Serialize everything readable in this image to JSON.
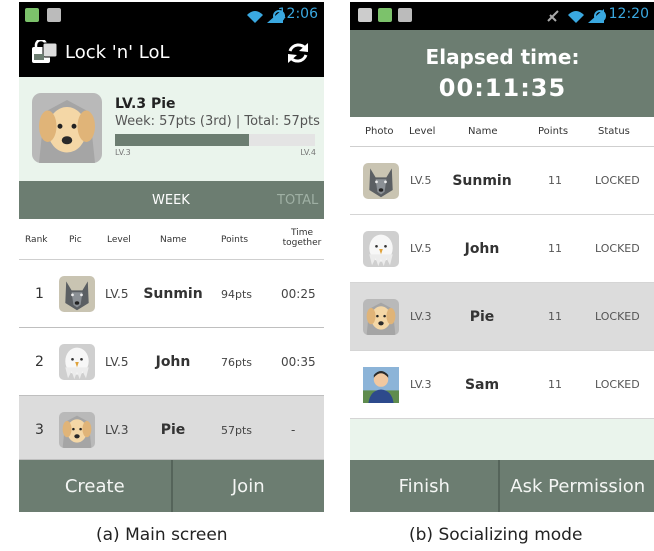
{
  "main_screen": {
    "status_time": "12:06",
    "app_title": "Lock 'n' LoL",
    "profile": {
      "name": "LV.3 Pie",
      "week_text": "Week: 57pts (3rd) | Total: 57pts",
      "level_from": "LV.3",
      "level_to": "LV.4",
      "progress": 0.67
    },
    "tabs": [
      "WEEK",
      "TOTAL"
    ],
    "headers": {
      "rank": "Rank",
      "pic": "Pic",
      "level": "Level",
      "name": "Name",
      "points": "Points",
      "time": "Time together"
    },
    "rows": [
      {
        "rank": "1",
        "level": "LV.5",
        "name": "Sunmin",
        "points": "94pts",
        "time": "00:25",
        "pic": "wolf-avatar"
      },
      {
        "rank": "2",
        "level": "LV.5",
        "name": "John",
        "points": "76pts",
        "time": "00:35",
        "pic": "eagle-avatar"
      },
      {
        "rank": "3",
        "level": "LV.3",
        "name": "Pie",
        "points": "57pts",
        "time": "-",
        "pic": "dog-avatar"
      }
    ],
    "buttons": {
      "create": "Create",
      "join": "Join"
    }
  },
  "social_screen": {
    "status_time": "12:20",
    "elapsed_label": "Elapsed time:",
    "elapsed_time": "00:11:35",
    "headers": {
      "photo": "Photo",
      "level": "Level",
      "name": "Name",
      "points": "Points",
      "status": "Status"
    },
    "rows": [
      {
        "level": "LV.5",
        "name": "Sunmin",
        "points": "11",
        "status": "LOCKED",
        "pic": "wolf-avatar"
      },
      {
        "level": "LV.5",
        "name": "John",
        "points": "11",
        "status": "LOCKED",
        "pic": "eagle-avatar"
      },
      {
        "level": "LV.3",
        "name": "Pie",
        "points": "11",
        "status": "LOCKED",
        "pic": "dog-avatar"
      },
      {
        "level": "LV.3",
        "name": "Sam",
        "points": "11",
        "status": "LOCKED",
        "pic": "person-photo"
      }
    ],
    "buttons": {
      "finish": "Finish",
      "ask_permission": "Ask Permission"
    }
  },
  "captions": {
    "a": "(a) Main screen",
    "b": "(b) Socializing mode"
  },
  "colors": {
    "accent": "#6c7d71",
    "light_bg": "#eaf4ec",
    "clock": "#3aa8e0"
  }
}
